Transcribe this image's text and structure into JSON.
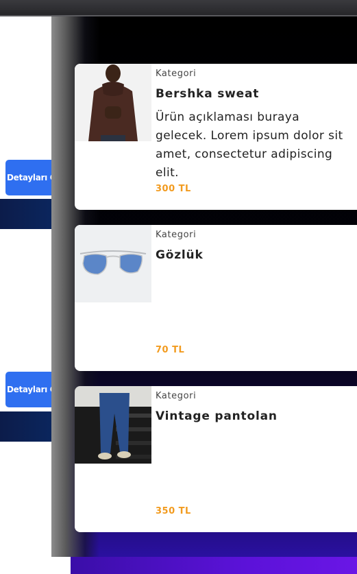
{
  "background": {
    "buttons": [
      {
        "label": "Detayları Gör"
      },
      {
        "label": "Detayları Gör"
      }
    ]
  },
  "products": [
    {
      "category": "Kategori",
      "title": "Bershka sweat",
      "description": "Ürün açıklaması buraya gelecek. Lorem ipsum dolor sit amet, consectetur adipiscing elit.",
      "price": "300 TL",
      "image": "hoodie-model-photo"
    },
    {
      "category": "Kategori",
      "title": "Gözlük",
      "description": "",
      "price": "70 TL",
      "image": "aviator-sunglasses-photo"
    },
    {
      "category": "Kategori",
      "title": "Vintage pantolan",
      "description": "",
      "price": "350 TL",
      "image": "jeans-stairs-photo"
    }
  ],
  "colors": {
    "accent_price": "#f29b1f",
    "button_blue": "#2f6ff0",
    "drawer_bottom": "#2a10a0"
  }
}
